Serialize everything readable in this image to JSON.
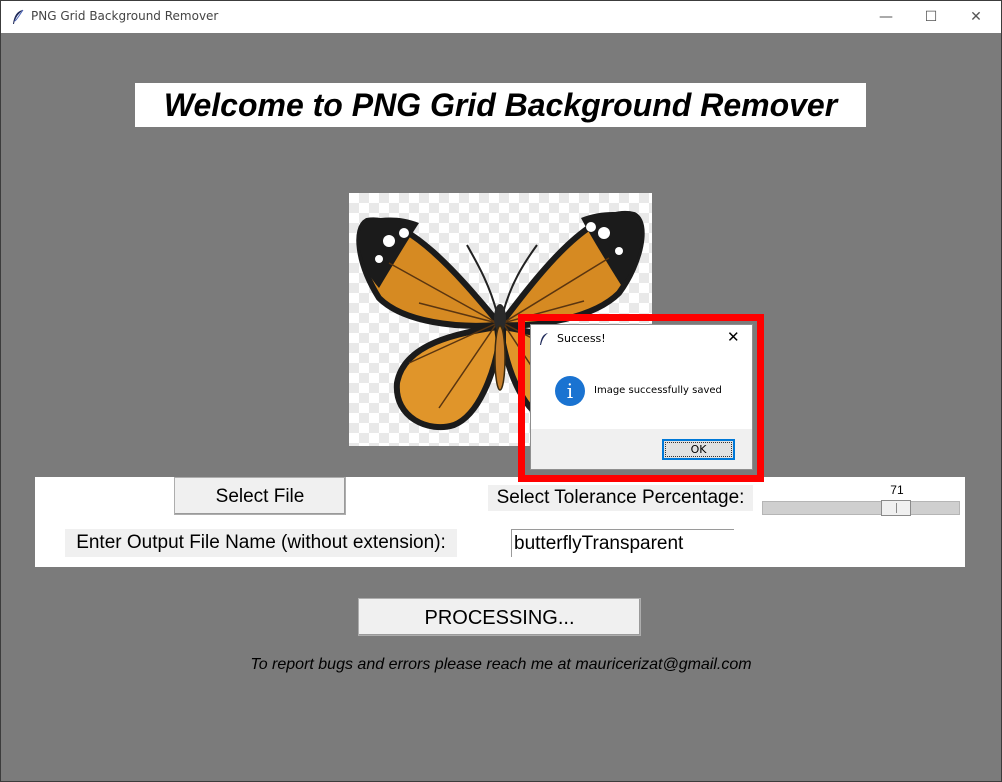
{
  "window": {
    "title": "PNG Grid Background Remover",
    "controls": {
      "minimize": "—",
      "maximize": "☐",
      "close": "✕"
    }
  },
  "header": {
    "welcome": "Welcome to PNG Grid Background Remover"
  },
  "preview": {
    "subject": "butterfly",
    "icon": "butterfly-image"
  },
  "controls": {
    "select_file_label": "Select File",
    "tolerance_label": "Select Tolerance Percentage:",
    "tolerance_value": "71",
    "output_label": "Enter Output File Name (without extension):",
    "output_value": "butterflyTransparent"
  },
  "process_button_label": "PROCESSING...",
  "footer": "To report bugs and errors please reach me at mauricerizat@gmail.com",
  "dialog": {
    "title": "Success!",
    "message": "Image successfully saved",
    "ok_label": "OK",
    "close_glyph": "✕",
    "info_glyph": "i",
    "info_color": "#1a73d1"
  },
  "colors": {
    "background": "#7b7b7b",
    "highlight": "#ff0000"
  }
}
